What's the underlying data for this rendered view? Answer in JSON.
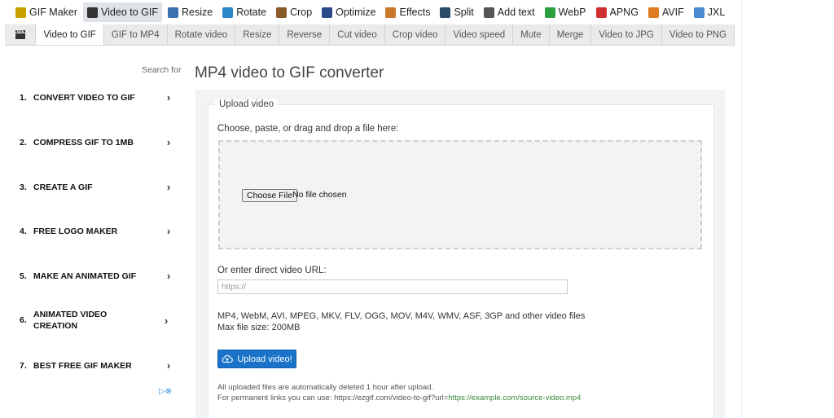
{
  "topnav": [
    {
      "label": "GIF Maker",
      "icon": "gif-maker-icon",
      "color": "#c8a000"
    },
    {
      "label": "Video to GIF",
      "icon": "video-icon",
      "color": "#333333",
      "active": true
    },
    {
      "label": "Resize",
      "icon": "resize-icon",
      "color": "#3a6fb0"
    },
    {
      "label": "Rotate",
      "icon": "rotate-icon",
      "color": "#2a88c8"
    },
    {
      "label": "Crop",
      "icon": "crop-icon",
      "color": "#8a5a2a"
    },
    {
      "label": "Optimize",
      "icon": "optimize-icon",
      "color": "#2a4a8a"
    },
    {
      "label": "Effects",
      "icon": "effects-icon",
      "color": "#c87a2a"
    },
    {
      "label": "Split",
      "icon": "split-icon",
      "color": "#2a4a6a"
    },
    {
      "label": "Add text",
      "icon": "add-text-icon",
      "color": "#555555"
    },
    {
      "label": "WebP",
      "icon": "webp-icon",
      "color": "#2aa040"
    },
    {
      "label": "APNG",
      "icon": "apng-icon",
      "color": "#d03030"
    },
    {
      "label": "AVIF",
      "icon": "avif-icon",
      "color": "#e07a20"
    },
    {
      "label": "JXL",
      "icon": "jxl-icon",
      "color": "#4a8ad0"
    }
  ],
  "subnav": [
    {
      "label": "Video to GIF",
      "active": true
    },
    {
      "label": "GIF to MP4"
    },
    {
      "label": "Rotate video"
    },
    {
      "label": "Resize"
    },
    {
      "label": "Reverse"
    },
    {
      "label": "Cut video"
    },
    {
      "label": "Crop video"
    },
    {
      "label": "Video speed"
    },
    {
      "label": "Mute"
    },
    {
      "label": "Merge"
    },
    {
      "label": "Video to JPG"
    },
    {
      "label": "Video to PNG"
    }
  ],
  "sidebar": {
    "search_label": "Search for",
    "items": [
      {
        "num": "1.",
        "label": "CONVERT VIDEO TO GIF"
      },
      {
        "num": "2.",
        "label": "COMPRESS GIF TO 1MB"
      },
      {
        "num": "3.",
        "label": "CREATE A GIF"
      },
      {
        "num": "4.",
        "label": "FREE LOGO MAKER"
      },
      {
        "num": "5.",
        "label": "MAKE AN ANIMATED GIF"
      },
      {
        "num": "6.",
        "label": "ANIMATED VIDEO CREATION"
      },
      {
        "num": "7.",
        "label": "BEST FREE GIF MAKER"
      }
    ]
  },
  "main": {
    "title": "MP4 video to GIF converter",
    "legend": "Upload video",
    "choose_label": "Choose, paste, or drag and drop a file here:",
    "file_button": "Choose File",
    "file_status": "No file chosen",
    "url_label": "Or enter direct video URL:",
    "url_placeholder": "https://",
    "formats": "MP4, WebM, AVI, MPEG, MKV, FLV, OGG, MOV, M4V, WMV, ASF, 3GP and other video files",
    "max_size": "Max file size: 200MB",
    "upload_button": "Upload video!",
    "note_delete": "All uploaded files are automatically deleted 1 hour after upload.",
    "note_permanent_prefix": "For permanent links you can use: https://ezgif.com/video-to-gif?url=",
    "note_permanent_link": "https://example.com/source-video.mp4"
  },
  "colors": {
    "accent": "#1a73c9",
    "panel_bg": "#f2f3f5",
    "subnav_bg": "#eaeaea",
    "link_green": "#3a8a3a"
  }
}
